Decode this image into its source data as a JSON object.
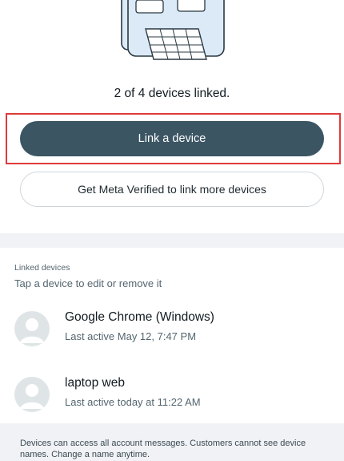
{
  "status": {
    "linked_count_text": "2 of 4 devices linked."
  },
  "actions": {
    "link_device_label": "Link a device",
    "meta_verified_label": "Get Meta Verified to link more devices"
  },
  "linked_devices": {
    "section_title": "Linked devices",
    "section_hint": "Tap a device to edit or remove it",
    "items": [
      {
        "name": "Google Chrome (Windows)",
        "last_active": "Last active May 12, 7:47 PM",
        "icon": "default-avatar-icon"
      },
      {
        "name": "laptop web",
        "last_active": "Last active today at 11:22 AM",
        "icon": "default-avatar-icon"
      }
    ]
  },
  "footer": {
    "note": "Devices can access all account messages. Customers cannot see device names. Change a name anytime."
  },
  "colors": {
    "primary_button": "#3b5563",
    "highlight_border": "#e03a3a",
    "illustration_fill": "#dbeaf6",
    "illustration_stroke": "#2a3942"
  }
}
